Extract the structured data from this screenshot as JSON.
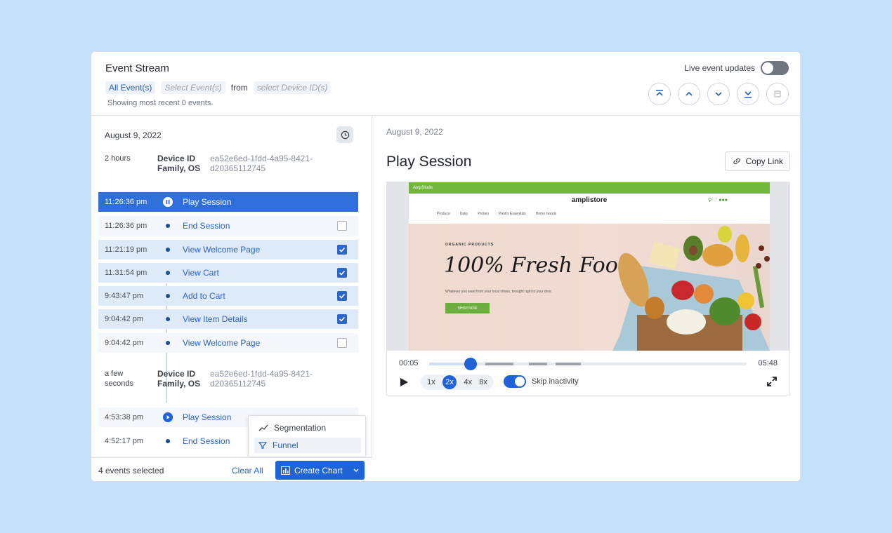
{
  "header": {
    "title": "Event Stream",
    "filter_all_events": "All Event(s)",
    "filter_select_events": "Select Event(s)",
    "filter_from": "from",
    "filter_device_ids": "select Device ID(s)",
    "showing": "Showing most recent 0 events.",
    "live_updates_label": "Live event updates",
    "live_updates_on": false
  },
  "left": {
    "date": "August 9, 2022",
    "groups": [
      {
        "age": "2 hours",
        "device_label": "Device ID Family, OS",
        "device_id": "ea52e6ed-1fdd-4a95-8421-d20365112745",
        "rows": [
          {
            "time": "11:26:36 pm",
            "name": "Play Session",
            "state": "selected"
          },
          {
            "time": "11:26:36 pm",
            "name": "End Session",
            "state": "unchecked"
          },
          {
            "time": "11:21:19 pm",
            "name": "View Welcome Page",
            "state": "checked"
          },
          {
            "time": "11:31:54 pm",
            "name": "View Cart",
            "state": "checked"
          },
          {
            "time": "9:43:47 pm",
            "name": "Add to Cart",
            "state": "checked"
          },
          {
            "time": "9:04:42 pm",
            "name": "View Item Details",
            "state": "checked"
          },
          {
            "time": "9:04:42 pm",
            "name": "View Welcome Page",
            "state": "unchecked"
          }
        ]
      },
      {
        "age": "a few seconds",
        "device_label": "Device ID Family, OS",
        "device_id": "ea52e6ed-1fdd-4a95-8421-d20365112745",
        "rows": [
          {
            "time": "4:53:38 pm",
            "name": "Play Session",
            "state": "play"
          },
          {
            "time": "4:52:17 pm",
            "name": "End Session",
            "state": "none"
          }
        ]
      }
    ],
    "footer": {
      "selected": "4 events selected",
      "clear_all": "Clear All",
      "create_chart": "Create Chart"
    },
    "dropdown": {
      "items": [
        "Segmentation",
        "Funnel"
      ]
    }
  },
  "right": {
    "date": "August 9, 2022",
    "title": "Play Session",
    "copy_link": "Copy Link",
    "website": {
      "brand": "AmpStude",
      "store_name": "amplistore",
      "tag": "ORGANIC PRODUCTS",
      "headline": "100% Fresh Food",
      "subline": "Whatever you want from your local stores, brought right to your door.",
      "cta": "SHOP NOW",
      "categories": [
        "Produce",
        "Dairy",
        "Protein",
        "Pantry Essentials",
        "Home Goods"
      ]
    },
    "player": {
      "current_time": "00:05",
      "total_time": "05:48",
      "progress": 0.019,
      "speeds": [
        "1x",
        "2x",
        "4x",
        "8x"
      ],
      "active_speed": "2x",
      "skip_inactivity": "Skip inactivity"
    }
  },
  "colors": {
    "background": "#c4e0fb",
    "accent": "#1f63d8",
    "selected_row": "#2f6fdc",
    "checked_row": "#dfeaf9",
    "site_green": "#71b73d"
  }
}
